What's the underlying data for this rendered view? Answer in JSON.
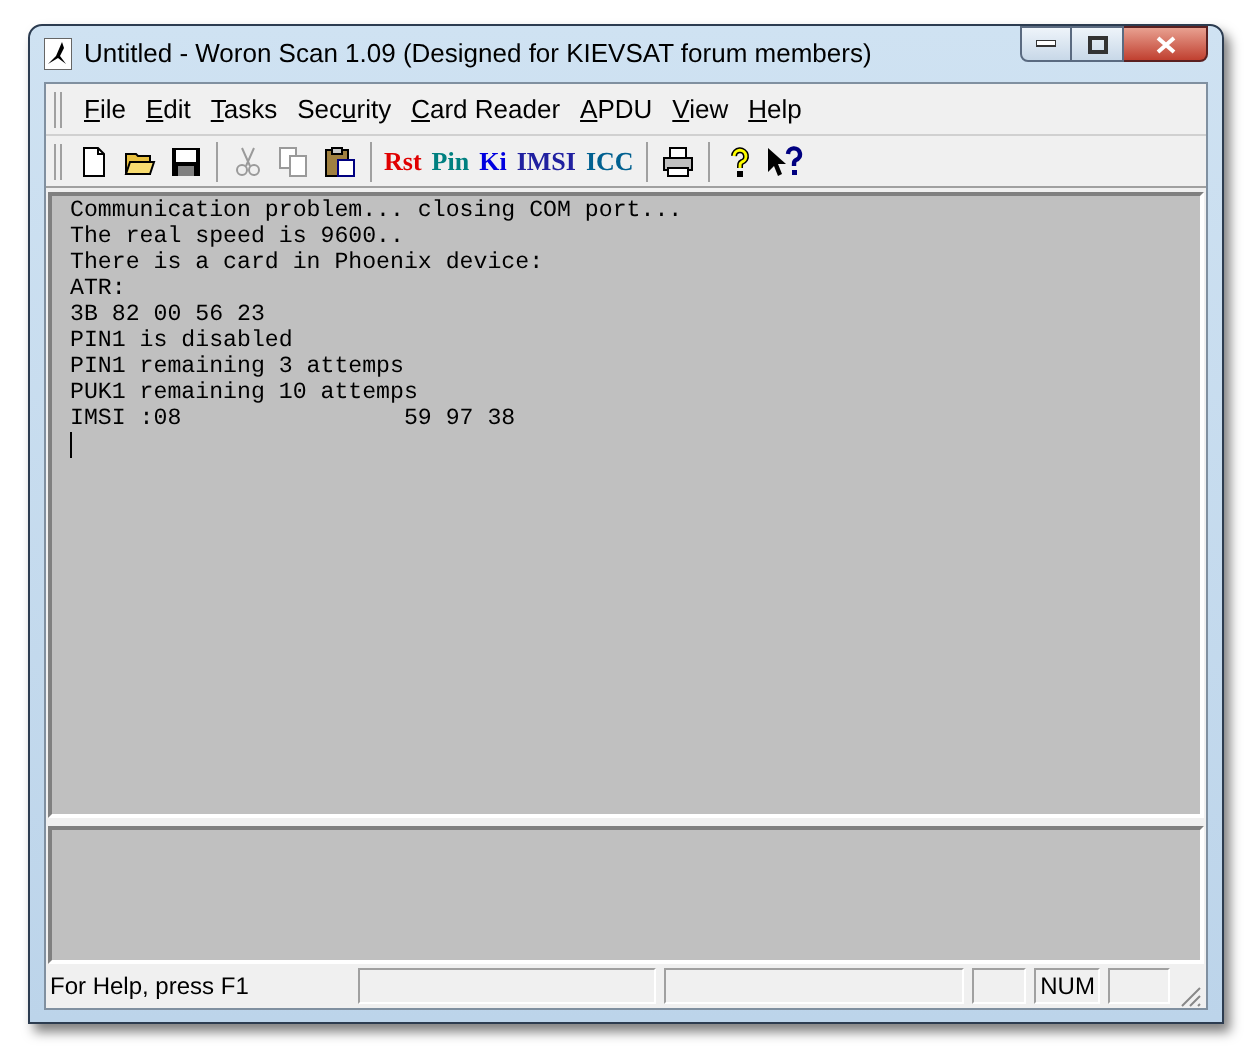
{
  "window": {
    "title": "Untitled - Woron Scan 1.09 (Designed for KIEVSAT forum members)"
  },
  "menu": [
    {
      "key": "F",
      "after": "ile"
    },
    {
      "key": "E",
      "after": "dit"
    },
    {
      "key": "T",
      "after": "asks"
    },
    {
      "before": "Sec",
      "key": "u",
      "after": "rity"
    },
    {
      "key": "C",
      "after": "ard Reader"
    },
    {
      "key": "A",
      "after": "PDU"
    },
    {
      "key": "V",
      "after": "iew"
    },
    {
      "key": "H",
      "after": "elp"
    }
  ],
  "toolbar": [
    {
      "kind": "icon"
    },
    {
      "kind": "icon"
    },
    {
      "kind": "icon"
    },
    {
      "kind": "separator"
    },
    {
      "kind": "icon",
      "disabled": true
    },
    {
      "kind": "icon",
      "disabled": true
    },
    {
      "kind": "icon",
      "disabled": false
    },
    {
      "kind": "separator"
    },
    {
      "kind": "text",
      "label": "Rst",
      "color": "#e00000"
    },
    {
      "kind": "text",
      "label": "Pin",
      "color": "#008080"
    },
    {
      "kind": "text",
      "label": "Ki",
      "color": "#0000e0"
    },
    {
      "kind": "text",
      "label": "IMSI",
      "color": "#2020a0"
    },
    {
      "kind": "text",
      "label": "ICC",
      "color": "#006090"
    },
    {
      "kind": "separator"
    },
    {
      "kind": "icon"
    },
    {
      "kind": "separator"
    },
    {
      "kind": "icon"
    },
    {
      "kind": "icon"
    }
  ],
  "console": {
    "lines": [
      "Communication problem... closing COM port...",
      "The real speed is 9600..",
      "There is a card in Phoenix device:",
      "ATR:",
      "3B 82 00 56 23",
      "PIN1 is disabled",
      "PIN1 remaining 3 attemps",
      "PUK1 remaining 10 attemps",
      "IMSI :08                59 97 38"
    ]
  },
  "status_bar": {
    "message": "For Help, press F1",
    "indicators": [
      {
        "text": "NUM"
      }
    ]
  }
}
